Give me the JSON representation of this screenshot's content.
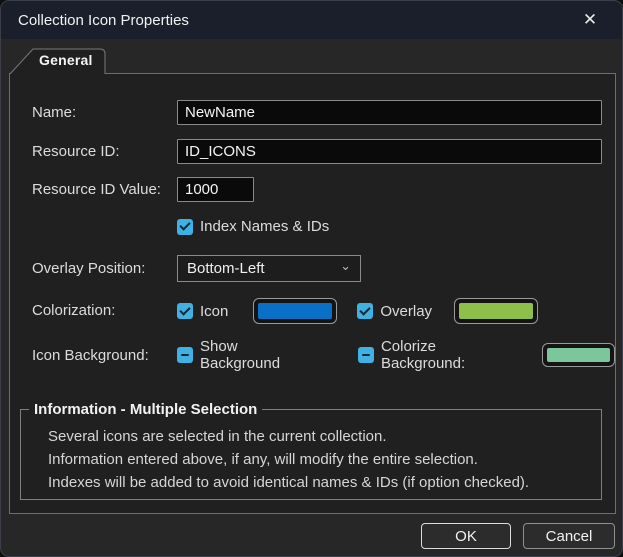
{
  "window": {
    "title": "Collection Icon Properties",
    "close_icon": "✕"
  },
  "tabs": {
    "general": {
      "label": "General"
    }
  },
  "icons": {
    "chevron_down": "⌄"
  },
  "form": {
    "name": {
      "label": "Name:",
      "value": "NewName"
    },
    "resource_id": {
      "label": "Resource ID:",
      "value": "ID_ICONS"
    },
    "resource_id_value": {
      "label": "Resource ID Value:",
      "value": "1000"
    },
    "index_names": {
      "label": "Index Names & IDs",
      "state": "checked"
    },
    "overlay_position": {
      "label": "Overlay Position:",
      "value": "Bottom-Left"
    },
    "colorization": {
      "label": "Colorization:",
      "icon_checkbox": {
        "label": "Icon",
        "state": "checked"
      },
      "icon_color": "#0a70c7",
      "overlay_checkbox": {
        "label": "Overlay",
        "state": "checked"
      },
      "overlay_color": "#8ebf4b"
    },
    "icon_background": {
      "label": "Icon Background:",
      "show_checkbox": {
        "label": "Show Background",
        "state": "indeterminate"
      },
      "colorize_checkbox": {
        "label": "Colorize Background:",
        "state": "indeterminate"
      },
      "background_color": "#7cc69b"
    }
  },
  "info_group": {
    "title": "Information - Multiple Selection",
    "lines": [
      "Several icons are selected in the current collection.",
      "Information entered above, if any, will modify the entire selection.",
      "Indexes will be added to avoid identical names & IDs (if option checked)."
    ]
  },
  "footer": {
    "ok_label": "OK",
    "cancel_label": "Cancel"
  },
  "colors": {
    "titlebar": "#1b1f2b",
    "checkbox_accent": "#41b1e1",
    "dialog_bg": "#272727"
  }
}
